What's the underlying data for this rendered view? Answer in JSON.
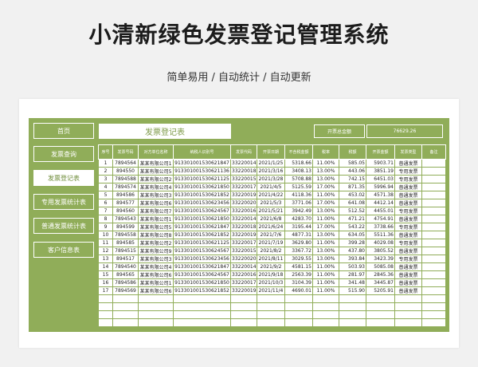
{
  "title": "小清新绿色发票登记管理系统",
  "subtitle": "简单易用 / 自动统计 / 自动更新",
  "nav": [
    "首页",
    "发票查询",
    "发票登记表",
    "专用发票统计表",
    "普通发票统计表",
    "客户信息表"
  ],
  "active_nav": 2,
  "header_title": "发票登记表",
  "total_label": "开票总金额",
  "total_value": "76629.26",
  "columns": [
    "序号",
    "发票号码",
    "对方单位名称",
    "纳税人识别号",
    "发票代码",
    "开票日期",
    "不含税金额",
    "税率",
    "税额",
    "开票金额",
    "发票类型",
    "备注"
  ],
  "rows": [
    [
      "1",
      "7894564",
      "某某有限公司1",
      "913301001530621847",
      "33220014",
      "2021/1/25",
      "5318.66",
      "11.00%",
      "585.05",
      "5903.71",
      "普通发票",
      ""
    ],
    [
      "2",
      "894550",
      "某某有限公司5",
      "913301001530621136",
      "33220018",
      "2021/3/16",
      "3408.13",
      "13.00%",
      "443.06",
      "3851.19",
      "专用发票",
      ""
    ],
    [
      "3",
      "7894588",
      "某某有限公司2",
      "913301001530621125",
      "33220015",
      "2021/3/28",
      "5708.88",
      "13.00%",
      "742.15",
      "6451.03",
      "专用发票",
      ""
    ],
    [
      "4",
      "7894574",
      "某某有限公司4",
      "913301001530621850",
      "33220017",
      "2021/4/5",
      "5125.59",
      "17.00%",
      "871.35",
      "5996.94",
      "普通发票",
      ""
    ],
    [
      "5",
      "894586",
      "某某有限公司3",
      "913301001530621852",
      "33220019",
      "2021/4/22",
      "4118.36",
      "11.00%",
      "453.02",
      "4571.38",
      "普通发票",
      ""
    ],
    [
      "6",
      "894577",
      "某某有限公司6",
      "913301001530623456",
      "33220020",
      "2021/5/3",
      "3771.06",
      "17.00%",
      "641.08",
      "4412.14",
      "普通发票",
      ""
    ],
    [
      "7",
      "894560",
      "某某有限公司7",
      "913301001530624567",
      "33220016",
      "2021/5/21",
      "3942.49",
      "13.00%",
      "512.52",
      "4455.01",
      "专用发票",
      ""
    ],
    [
      "8",
      "7894543",
      "某某有限公司1",
      "913301001530621850",
      "33220014",
      "2021/6/8",
      "4283.70",
      "11.00%",
      "471.21",
      "4754.91",
      "普通发票",
      ""
    ],
    [
      "9",
      "894599",
      "某某有限公司5",
      "913301001530621847",
      "33220018",
      "2021/6/24",
      "3195.44",
      "17.00%",
      "543.22",
      "3738.66",
      "专用发票",
      ""
    ],
    [
      "10",
      "7894558",
      "某某有限公司8",
      "913301001530621852",
      "33220019",
      "2021/7/6",
      "4877.31",
      "13.00%",
      "634.05",
      "5511.36",
      "普通发票",
      ""
    ],
    [
      "11",
      "894585",
      "某某有限公司2",
      "913301001530621125",
      "33220017",
      "2021/7/19",
      "3629.80",
      "11.00%",
      "399.28",
      "4029.08",
      "专用发票",
      ""
    ],
    [
      "12",
      "7894515",
      "某某有限公司9",
      "913301001530624567",
      "33220015",
      "2021/8/2",
      "3367.72",
      "13.00%",
      "437.80",
      "3805.52",
      "普通发票",
      ""
    ],
    [
      "13",
      "894517",
      "某某有限公司3",
      "913301001530623456",
      "33220020",
      "2021/8/11",
      "3029.55",
      "13.00%",
      "393.84",
      "3423.39",
      "专用发票",
      ""
    ],
    [
      "14",
      "7894540",
      "某某有限公司4",
      "913301001530621847",
      "33220014",
      "2021/9/2",
      "4581.15",
      "11.00%",
      "503.93",
      "5085.08",
      "普通发票",
      ""
    ],
    [
      "15",
      "894565",
      "某某有限公司6",
      "913301001530624567",
      "33220016",
      "2021/9/18",
      "2563.39",
      "11.00%",
      "281.97",
      "2845.36",
      "普通发票",
      ""
    ],
    [
      "16",
      "7894586",
      "某某有限公司1",
      "913301001530621850",
      "33220017",
      "2021/10/3",
      "3104.39",
      "11.00%",
      "341.48",
      "3445.87",
      "普通发票",
      ""
    ],
    [
      "17",
      "7894569",
      "某某有限公司6",
      "913301001530621852",
      "33220019",
      "2021/11/4",
      "4690.01",
      "11.00%",
      "515.90",
      "5205.91",
      "普通发票",
      ""
    ]
  ],
  "blank_rows": 4,
  "colors": {
    "green": "#90ad59",
    "accent": "#7d9a48"
  }
}
